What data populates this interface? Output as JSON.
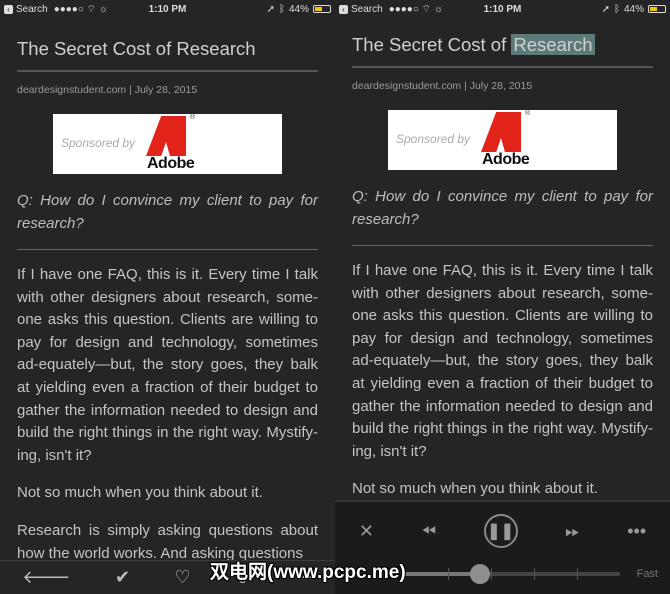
{
  "status": {
    "back_label": "Search",
    "time": "1:10 PM",
    "battery": "44%",
    "battery_level": 0.44
  },
  "article": {
    "title_prefix": "The Secret Cost of ",
    "title_highlight": "Research",
    "meta": "deardesignstudent.com | July 28, 2015",
    "ad": {
      "sponsored": "Sponsored by",
      "brand": "Adobe",
      "reg": "®"
    },
    "question": "Q: How do I convince my client to pay for research?",
    "paragraphs": [
      "If I have one FAQ, this is it. Every time I talk with other designers about research, some-one asks this question. Clients are willing to pay for design and technology, sometimes ad-equately—but, the story goes, they balk at yielding even a fraction of their budget to gather the information needed to design and build the right things in the right way. Mystify-ing, isn't it?",
      "Not so much when you think about it.",
      "Research is simply asking questions about how the world works. And asking questions"
    ]
  },
  "player": {
    "speed_label": "Fast",
    "speed_position": 0.35
  },
  "watermark": "双电网(www.pcpc.me)"
}
